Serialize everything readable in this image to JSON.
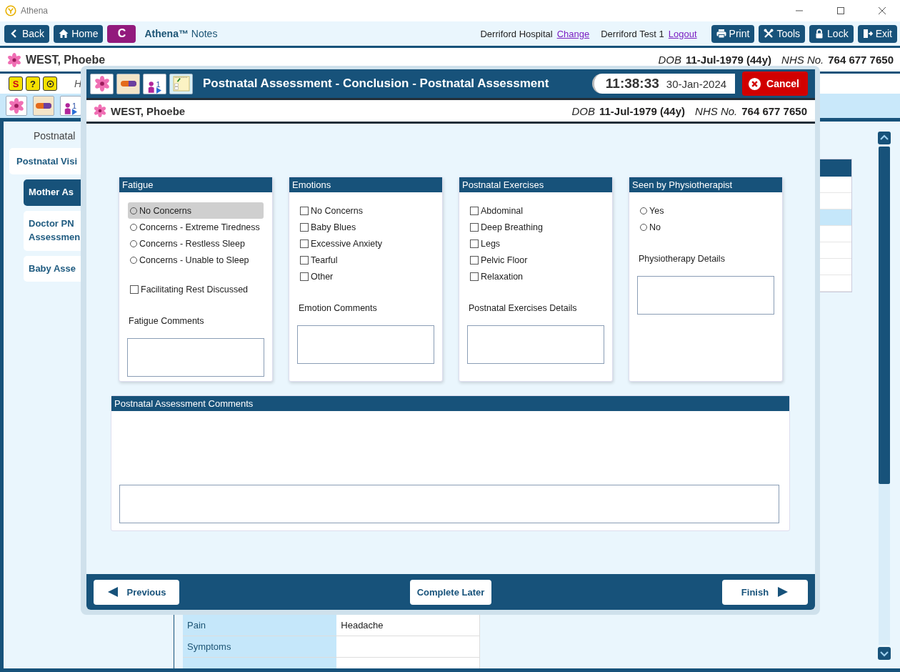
{
  "window": {
    "title": "Athena"
  },
  "toolbar": {
    "nav_buttons": [
      {
        "kind": "back",
        "label": "Back"
      },
      {
        "kind": "home",
        "label": "Home"
      }
    ],
    "context_badge": "C",
    "app_name": "**Athena™** Notes",
    "location": "Derriford Hospital",
    "location_link": "Change",
    "user": "Derriford Test 1",
    "user_link": "Logout",
    "action_buttons": [
      {
        "kind": "print",
        "label": "Print"
      },
      {
        "kind": "tools",
        "label": "Tools"
      },
      {
        "kind": "lock",
        "label": "Lock"
      },
      {
        "kind": "exit",
        "label": "Exit"
      }
    ]
  },
  "patient_banner": {
    "name": "WEST, Phoebe",
    "dob_label": "DOB",
    "dob": "11-Jul-1979 (44y)",
    "nhs_label": "NHS No.",
    "nhs": "764 677 7650"
  },
  "alert_icons": [
    {
      "kind": "alert",
      "glyph": "S"
    },
    {
      "kind": "help",
      "glyph": "?"
    },
    {
      "kind": "settings"
    }
  ],
  "alert_text": "H",
  "record_icons": [
    {
      "kind": "flower"
    },
    {
      "kind": "pill"
    },
    {
      "kind": "baby",
      "count": "1"
    }
  ],
  "sidebar": {
    "heading": "Postnatal",
    "items": [
      {
        "label": "Postnatal Visi",
        "selected": false,
        "children": [
          {
            "label": "Mother As",
            "selected": true
          },
          {
            "label": "Doctor PN Assessmen",
            "selected": false
          },
          {
            "label": "Baby Asse",
            "selected": false
          }
        ]
      }
    ]
  },
  "side_table": {
    "rows": [
      {
        "selected": false
      },
      {
        "selected": false
      },
      {
        "selected": true
      },
      {
        "selected": false
      },
      {
        "selected": false
      },
      {
        "selected": false
      },
      {
        "selected": false
      }
    ]
  },
  "findings_table": {
    "rows": [
      {
        "label": "Pain",
        "value": "Headache"
      },
      {
        "label": "Symptoms"
      }
    ]
  },
  "dialog": {
    "icons": [
      {
        "kind": "flower"
      },
      {
        "kind": "pill"
      },
      {
        "kind": "baby",
        "count": "1"
      },
      {
        "kind": "notes"
      }
    ],
    "title": "Postnatal Assessment - Conclusion - Postnatal Assessment",
    "time": "11:38:33",
    "date": "30-Jan-2024",
    "cancel": "Cancel",
    "patient": {
      "name": "WEST, Phoebe",
      "dob_label": "DOB",
      "dob": "11-Jul-1979 (44y)",
      "nhs_label": "NHS No.",
      "nhs": "764 677 7650"
    },
    "sections": [
      {
        "title": "Fatigue",
        "options": [
          {
            "kind": "radio",
            "label": "No Concerns",
            "selected": false,
            "focused": true
          },
          {
            "kind": "radio",
            "label": "Concerns - Extreme Tiredness",
            "selected": false,
            "focused": false
          },
          {
            "kind": "radio",
            "label": "Concerns - Restless Sleep",
            "selected": false,
            "focused": false
          },
          {
            "kind": "radio",
            "label": "Concerns - Unable to Sleep",
            "selected": false,
            "focused": false
          }
        ],
        "extras": [
          {
            "kind": "checkbox",
            "label": "Facilitating Rest Discussed",
            "checked": false
          }
        ],
        "comment_label": "Fatigue Comments"
      },
      {
        "title": "Emotions",
        "options": [
          {
            "kind": "checkbox",
            "label": "No Concerns",
            "checked": false
          },
          {
            "kind": "checkbox",
            "label": "Baby Blues",
            "checked": false
          },
          {
            "kind": "checkbox",
            "label": "Excessive Anxiety",
            "checked": false
          },
          {
            "kind": "checkbox",
            "label": "Tearful",
            "checked": false
          },
          {
            "kind": "checkbox",
            "label": "Other",
            "checked": false
          }
        ],
        "comment_label": "Emotion Comments"
      },
      {
        "title": "Postnatal Exercises",
        "options": [
          {
            "kind": "checkbox",
            "label": "Abdominal",
            "checked": false
          },
          {
            "kind": "checkbox",
            "label": "Deep Breathing",
            "checked": false
          },
          {
            "kind": "checkbox",
            "label": "Legs",
            "checked": false
          },
          {
            "kind": "checkbox",
            "label": "Pelvic Floor",
            "checked": false
          },
          {
            "kind": "checkbox",
            "label": "Relaxation",
            "checked": false
          }
        ],
        "comment_label": "Postnatal Exercises Details"
      },
      {
        "title": "Seen by Physiotherapist",
        "options": [
          {
            "kind": "radio",
            "label": "Yes",
            "selected": false,
            "focused": false
          },
          {
            "kind": "radio",
            "label": "No",
            "selected": false,
            "focused": false
          }
        ],
        "comment_label": "Physiotherapy Details"
      }
    ],
    "comments": {
      "title": "Postnatal Assessment Comments"
    },
    "footer": {
      "previous": "Previous",
      "later": "Complete Later",
      "finish": "Finish"
    }
  }
}
